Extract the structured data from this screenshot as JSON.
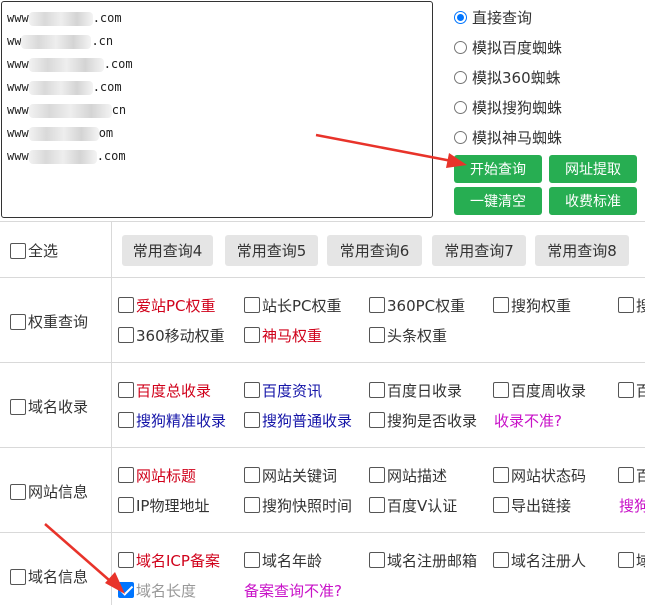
{
  "url_box": {
    "lines": [
      {
        "prefix": "www",
        "suffix": ".com"
      },
      {
        "prefix": "ww",
        "suffix": ".cn"
      },
      {
        "prefix": "www",
        "suffix": ".com"
      },
      {
        "prefix": "www",
        "suffix": ".com"
      },
      {
        "prefix": "www",
        "suffix": "cn"
      },
      {
        "prefix": "www",
        "suffix": "om"
      },
      {
        "prefix": "www",
        "suffix": ".com"
      }
    ]
  },
  "modes": {
    "options": [
      "直接查询",
      "模拟百度蜘蛛",
      "模拟360蜘蛛",
      "模拟搜狗蜘蛛",
      "模拟神马蜘蛛"
    ],
    "selected": "直接查询"
  },
  "actions": {
    "start": "开始查询",
    "extract": "网址提取",
    "clear": "一键清空",
    "pricing": "收费标准"
  },
  "header_row": {
    "select_all": "全选",
    "presets": [
      "常用查询4",
      "常用查询5",
      "常用查询6",
      "常用查询7",
      "常用查询8"
    ]
  },
  "groups": {
    "weight": {
      "label": "权重查询",
      "row1": [
        "爱站PC权重",
        "站长PC权重",
        "360PC权重",
        "搜狗权重",
        "搜"
      ],
      "row2": [
        "360移动权重",
        "神马权重",
        "头条权重"
      ]
    },
    "index": {
      "label": "域名收录",
      "row1": [
        "百度总收录",
        "百度资讯",
        "百度日收录",
        "百度周收录",
        "百"
      ],
      "row2": [
        "搜狗精准收录",
        "搜狗普通收录",
        "搜狗是否收录"
      ],
      "note": "收录不准?"
    },
    "site": {
      "label": "网站信息",
      "row1": [
        "网站标题",
        "网站关键词",
        "网站描述",
        "网站状态码",
        "百"
      ],
      "row2": [
        "IP物理地址",
        "搜狗快照时间",
        "百度V认证",
        "导出链接",
        "搜狗"
      ]
    },
    "domain": {
      "label": "域名信息",
      "row1": [
        "域名ICP备案",
        "域名年龄",
        "域名注册邮箱",
        "域名注册人",
        "域"
      ],
      "row2": [
        "域名长度"
      ],
      "note": "备案查询不准?"
    }
  },
  "colors": {
    "green_button": "#27ae52",
    "gray_button": "#e5e5e5",
    "red_text": "#d0021b",
    "blue_text": "#1515a8",
    "magenta_text": "#c812c8",
    "annotation_arrow": "#e8332a",
    "checkbox_checked": "#0075ff"
  }
}
